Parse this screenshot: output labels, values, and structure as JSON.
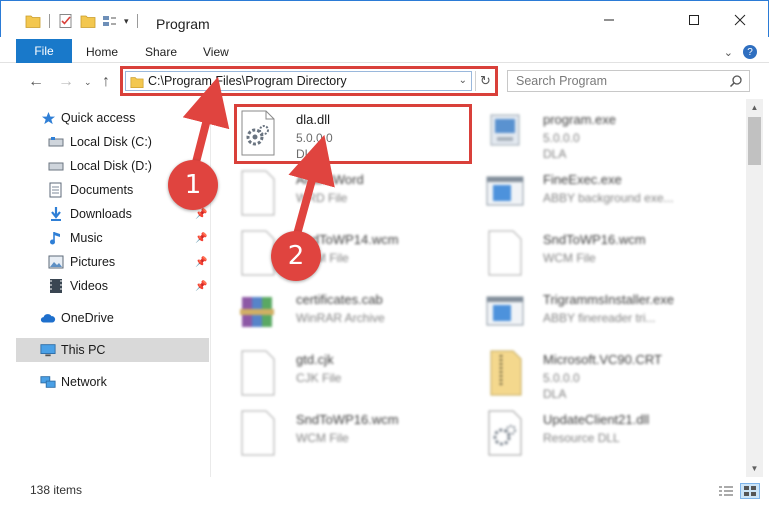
{
  "window": {
    "title": "Program",
    "minimize_icon": "minimize-icon",
    "maximize_icon": "maximize-icon",
    "close_icon": "close-icon"
  },
  "ribbon": {
    "tabs": [
      {
        "label": "File"
      },
      {
        "label": "Home"
      },
      {
        "label": "Share"
      },
      {
        "label": "View"
      }
    ]
  },
  "address": {
    "path": "C:\\Program Files\\Program Directory",
    "search_placeholder": "Search Program"
  },
  "sidebar": {
    "items": [
      {
        "label": "Quick access",
        "icon": "star-icon",
        "pinned": false
      },
      {
        "label": "Local Disk (C:)",
        "icon": "drive-icon",
        "pinned": false
      },
      {
        "label": "Local Disk (D:)",
        "icon": "drive-icon",
        "pinned": false
      },
      {
        "label": "Documents",
        "icon": "documents-icon",
        "pinned": false
      },
      {
        "label": "Downloads",
        "icon": "download-icon",
        "pinned": true
      },
      {
        "label": "Music",
        "icon": "music-icon",
        "pinned": true
      },
      {
        "label": "Pictures",
        "icon": "pictures-icon",
        "pinned": true
      },
      {
        "label": "Videos",
        "icon": "videos-icon",
        "pinned": true
      },
      {
        "label": "OneDrive",
        "icon": "cloud-icon",
        "pinned": false
      },
      {
        "label": "This PC",
        "icon": "computer-icon",
        "pinned": false
      },
      {
        "label": "Network",
        "icon": "network-icon",
        "pinned": false
      }
    ]
  },
  "files": [
    {
      "name": "dla.dll",
      "line2": "5.0.0.0",
      "line3": "DLA",
      "icon": "dll-gear-icon",
      "highlighted": true
    },
    {
      "name": "program.exe",
      "line2": "5.0.0.0",
      "line3": "DLA",
      "icon": "exe-icon"
    },
    {
      "name": "ArabicWord",
      "line2": "WRD File",
      "line3": "",
      "icon": "blank-file-icon"
    },
    {
      "name": "FineExec.exe",
      "line2": "ABBY background exe...",
      "line3": "",
      "icon": "window-app-icon"
    },
    {
      "name": "SndToWP14.wcm",
      "line2": "WCM File",
      "line3": "",
      "icon": "blank-file-icon"
    },
    {
      "name": "SndToWP16.wcm",
      "line2": "WCM File",
      "line3": "",
      "icon": "blank-file-icon"
    },
    {
      "name": "certificates.cab",
      "line2": "WinRAR Archive",
      "line3": "",
      "icon": "winrar-icon"
    },
    {
      "name": "TrigrammsInstaller.exe",
      "line2": "ABBY finereader tri...",
      "line3": "",
      "icon": "window-app-icon"
    },
    {
      "name": "gtd.cjk",
      "line2": "CJK File",
      "line3": "",
      "icon": "blank-file-icon"
    },
    {
      "name": "Microsoft.VC90.CRT",
      "line2": "5.0.0.0",
      "line3": "DLA",
      "icon": "zipper-file-icon"
    },
    {
      "name": "SndToWP16.wcm",
      "line2": "WCM File",
      "line3": "",
      "icon": "blank-file-icon"
    },
    {
      "name": "UpdateClient21.dll",
      "line2": "Resource DLL",
      "line3": "",
      "icon": "dll-gear-icon"
    }
  ],
  "status": {
    "item_count": "138 items"
  },
  "annotations": {
    "step1": "1",
    "step2": "2",
    "color": "#e0443f"
  }
}
